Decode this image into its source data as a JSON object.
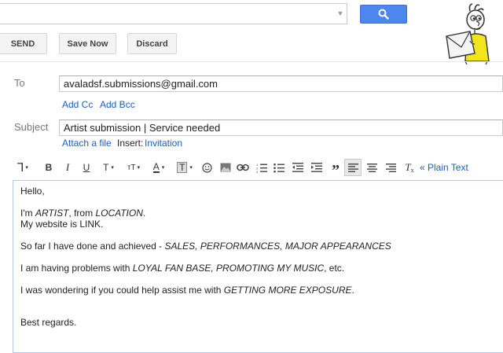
{
  "search": {
    "placeholder": "",
    "button_icon": "search-icon"
  },
  "toolbar_top": {
    "send_label": "SEND",
    "save_label": "Save Now",
    "discard_label": "Discard"
  },
  "compose": {
    "to_label": "To",
    "to_value": "avaladsf.submissions@gmail.com",
    "add_cc": "Add Cc",
    "add_bcc": "Add Bcc",
    "subject_label": "Subject",
    "subject_value": "Artist submission | Service needed",
    "attach_file": "Attach a file",
    "insert_label": "Insert:",
    "invitation": "Invitation"
  },
  "formatting": {
    "plain_text": "« Plain Text",
    "icons": [
      "font-icon",
      "bold-icon",
      "italic-icon",
      "underline-icon",
      "text-size-icon",
      "font-size-icon",
      "text-color-icon",
      "highlight-color-icon",
      "emoticon-icon",
      "image-icon",
      "link-icon",
      "numbered-list-icon",
      "bulleted-list-icon",
      "indent-less-icon",
      "indent-more-icon",
      "quote-icon",
      "align-left-icon",
      "align-center-icon",
      "align-right-icon",
      "remove-formatting-icon"
    ]
  },
  "body": {
    "greeting": "Hello,",
    "line1_pre": "I'm ",
    "line1_artist": "ARTIST",
    "line1_mid": ", from ",
    "line1_location": "LOCATION",
    "line1_end": ".",
    "line2": "My website is LINK.",
    "line3_pre": "So far I have done and achieved - ",
    "line3_em": "SALES, PERFORMANCES, MAJOR APPEARANCES",
    "line4_pre": "I am having problems with ",
    "line4_em": "LOYAL FAN BASE, PROMOTING MY MUSIC",
    "line4_end": ", etc.",
    "line5_pre": "I was wondering if you could help assist me with ",
    "line5_em": "GETTING MORE EXPOSURE",
    "line5_end": ".",
    "closing": "Best regards."
  },
  "colors": {
    "accent": "#4d87ee",
    "link": "#1a5ec3",
    "mascot_shirt": "#f2e51b"
  }
}
